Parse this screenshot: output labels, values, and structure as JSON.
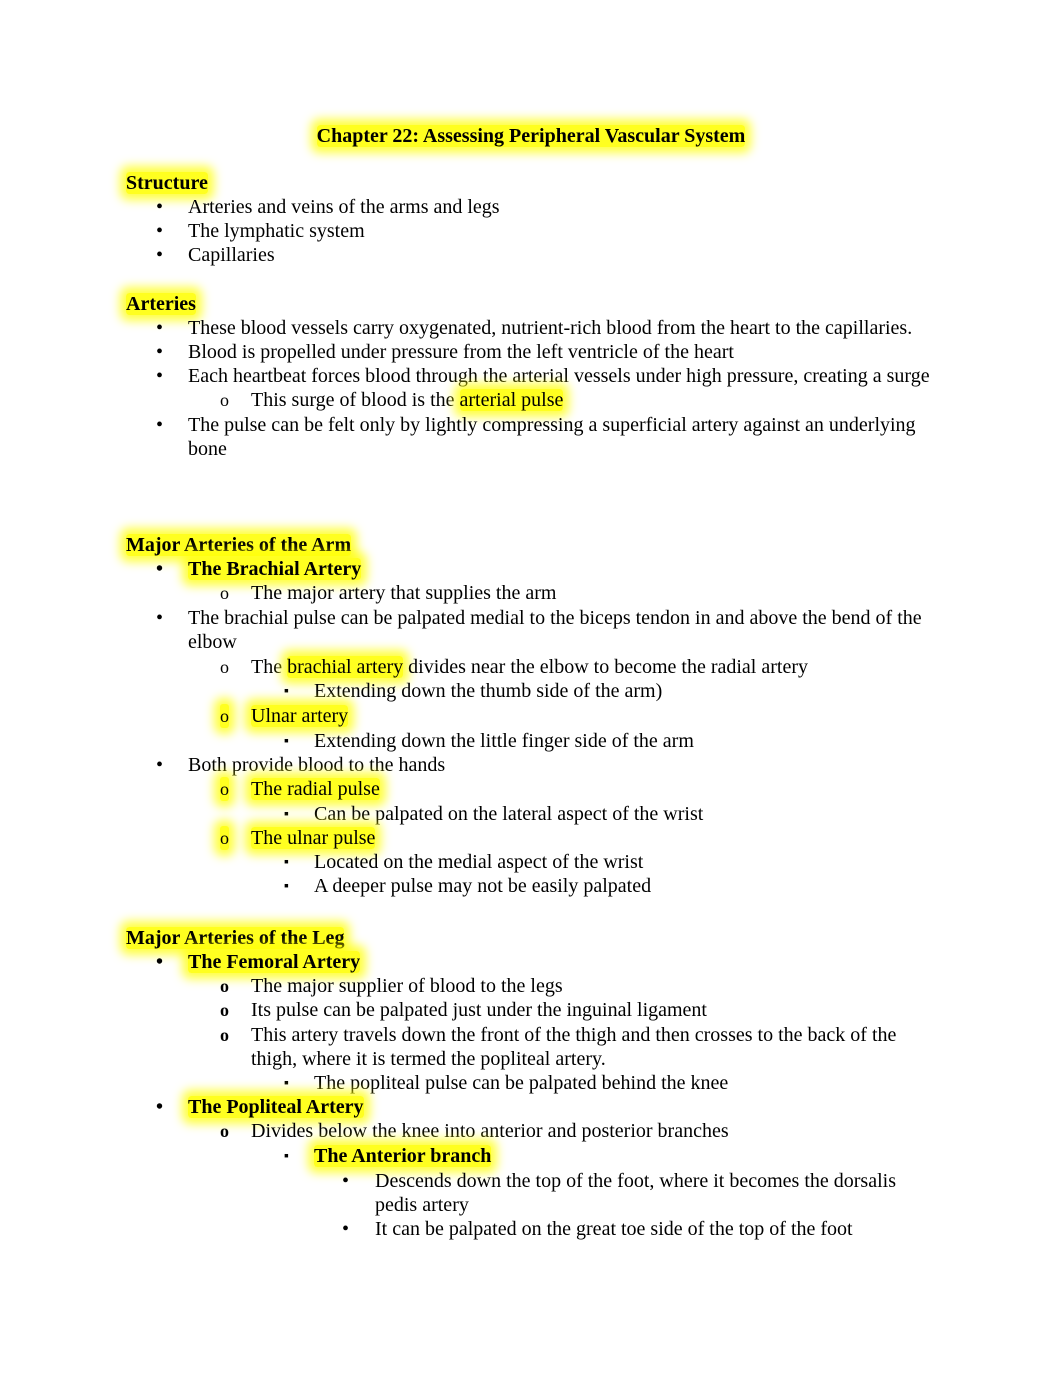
{
  "document": {
    "title": "Chapter 22: Assessing Peripheral Vascular System",
    "highlight_color": "#ffff00",
    "bullets": {
      "level1": "•",
      "level2": "o",
      "level3": "▪",
      "level4": "•"
    }
  },
  "structure": {
    "heading": "Structure",
    "items": [
      "Arteries and veins of the arms and legs",
      "The lymphatic system",
      "Capillaries"
    ]
  },
  "arteries": {
    "heading": "Arteries",
    "items": [
      "These blood vessels carry oxygenated, nutrient-rich blood from the heart to the capillaries.",
      "Blood is propelled under pressure from the left ventricle of the heart",
      "Each heartbeat forces blood through the arterial vessels under high pressure, creating a surge",
      "The pulse can be felt only by lightly compressing a superficial artery against an underlying bone"
    ],
    "sub": {
      "prefix": "This surge of blood is the ",
      "highlight": "arterial pulse"
    }
  },
  "arm": {
    "heading": "Major Arteries of the Arm",
    "brachial_title": "The Brachial Artery",
    "brachial_desc": "The major artery that supplies the arm",
    "brachial_pulse": "The brachial pulse can be palpated medial to the biceps tendon in and above the bend of the elbow",
    "divides_prefix": "The ",
    "divides_highlight": "brachial artery",
    "divides_suffix": " divides near the elbow to become the radial artery",
    "thumb_side": "Extending down the thumb side of the arm)",
    "ulnar_artery": "Ulnar artery",
    "little_finger": "Extending down the little finger side of the arm",
    "both": "Both provide blood to the hands",
    "radial_pulse": "The radial pulse",
    "radial_desc": "Can be palpated on the lateral aspect of the wrist",
    "ulnar_pulse": "The ulnar pulse",
    "ulnar_desc1": "Located on the medial aspect of the wrist",
    "ulnar_desc2": "A deeper pulse may not be easily palpated"
  },
  "leg": {
    "heading": "Major Arteries of the Leg",
    "femoral_title": "The Femoral Artery",
    "femoral_items": [
      "The major supplier of blood to the legs",
      "Its pulse can be palpated just under the inguinal ligament",
      "This artery travels down the front of the thigh and then crosses to the back of the thigh, where it is termed the popliteal artery."
    ],
    "popliteal_pulse": "The popliteal pulse can be palpated behind the knee",
    "popliteal_title": "The Popliteal Artery",
    "divides": "Divides below the knee into anterior and posterior branches",
    "anterior_title": "The Anterior branch",
    "anterior_items": [
      "Descends down the top of the foot, where it becomes the dorsalis pedis artery",
      "It can be palpated on the great toe side of the top of the foot"
    ]
  }
}
